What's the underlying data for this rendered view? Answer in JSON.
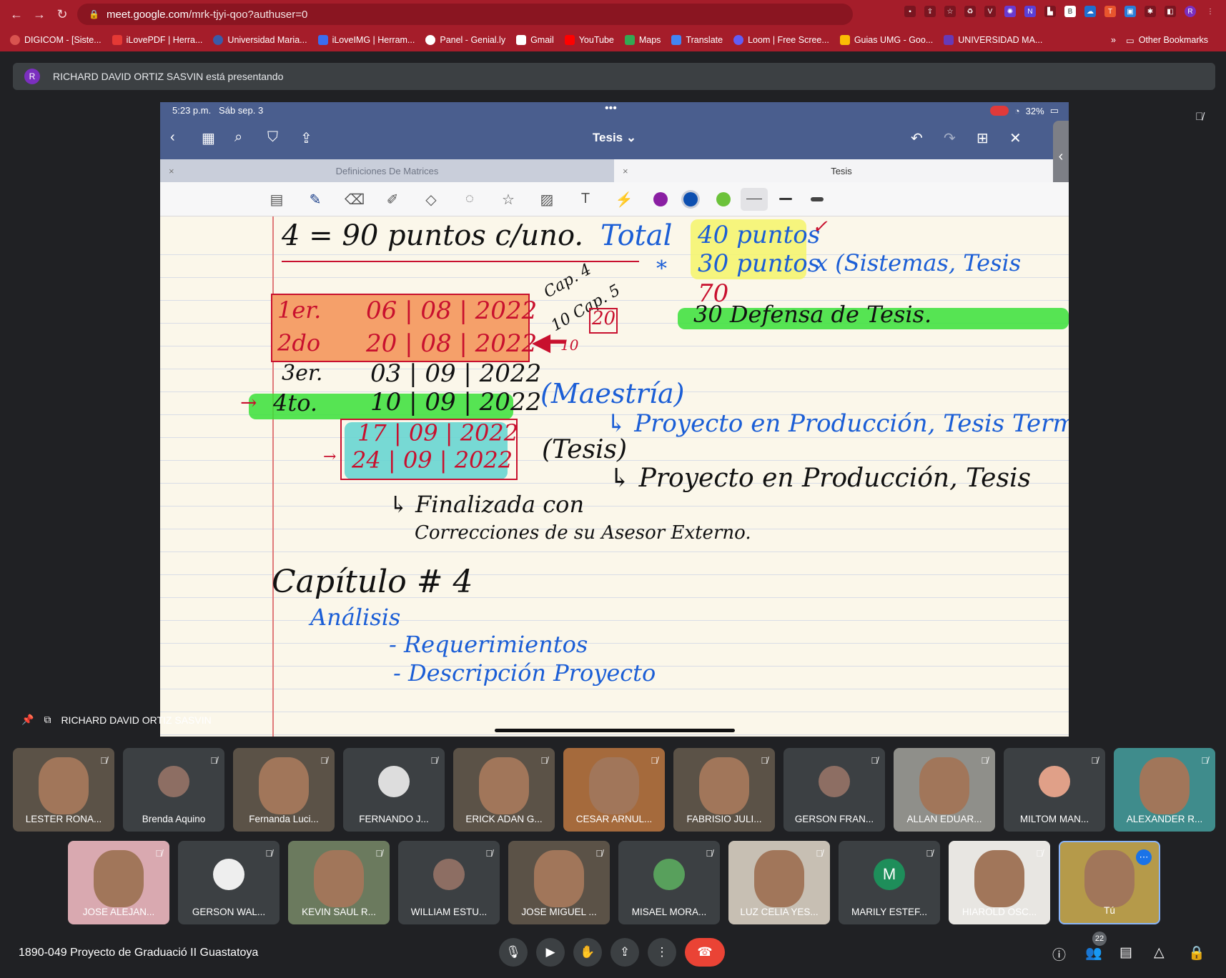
{
  "browser": {
    "url_host": "meet.google.com",
    "url_path": "/mrk-tjyi-qoo?authuser=0",
    "bookmarks": [
      "DIGICOM - [Siste...",
      "iLovePDF | Herra...",
      "Universidad Maria...",
      "iLoveIMG | Herram...",
      "Panel - Genial.ly",
      "Gmail",
      "YouTube",
      "Maps",
      "Translate",
      "Loom | Free Scree...",
      "Guias UMG - Goo...",
      "UNIVERSIDAD MA..."
    ],
    "more_bookmarks": "»",
    "other_bookmarks": "Other Bookmarks",
    "profile_initial": "R"
  },
  "presenter_bar": {
    "initial": "R",
    "text": "RICHARD DAVID ORTIZ SASVIN está presentando"
  },
  "ipad": {
    "time": "5:23 p.m.",
    "date": "Sáb sep. 3",
    "battery": "32%",
    "title": "Tesis ⌄",
    "tabs": [
      "Definiciones De Matrices",
      "Tesis"
    ]
  },
  "notes": {
    "line1": "4 = 90 puntos c/uno.",
    "total": "Total",
    "p40": "40 puntos",
    "p30": "30 puntos",
    "sistemas": "x (Sistemas, Tesis",
    "p70": "70",
    "p30b": "30 Defensa de Tesis.",
    "cap4": "Cap. 4",
    "cap5": "10 Cap. 5",
    "ten": "10",
    "ten2": "10",
    "twenty": "20",
    "d1_label": "1er.",
    "d1": "06 | 08 | 2022",
    "d2_label": "2do",
    "d2": "20 | 08 | 2022",
    "d3_label": "3er.",
    "d3": "03 | 09 | 2022",
    "d4_label": "4to.",
    "d4": "10 | 09 | 2022",
    "d5": "17 | 09 | 2022",
    "d6": "24 | 09 | 2022",
    "maestria": "(Maestría)",
    "maestria_sub": "↳ Proyecto en Producción, Tesis Term",
    "tesis": "(Tesis)",
    "tesis_sub": "↳ Proyecto en Producción, Tesis",
    "finalizada": "↳ Finalizada con",
    "correcciones": "Correcciones de su Asesor Externo.",
    "capitulo": "Capítulo # 4",
    "analisis": "Análisis",
    "req": "- Requerimientos",
    "desc": "- Descripción Proyecto"
  },
  "pinned_label": "RICHARD DAVID ORTIZ SASVIN",
  "participants_row1": [
    "LESTER RONA...",
    "Brenda Aquino",
    "Fernanda Luci...",
    "FERNANDO J...",
    "ERICK ADAN G...",
    "CESAR ARNUL...",
    "FABRISIO JULI...",
    "GERSON FRAN...",
    "ALLAN EDUAR...",
    "MILTOM MAN...",
    "ALEXANDER R..."
  ],
  "participants_row2": [
    "JOSE ALEJAN...",
    "GERSON WAL...",
    "KEVIN SAUL R...",
    "WILLIAM ESTU...",
    "JOSE MIGUEL ...",
    "MISAEL MORA...",
    "LUZ CELIA YES...",
    "MARILY ESTEF...",
    "HIAROLD OSC...",
    "Tú"
  ],
  "marily_initial": "M",
  "meeting": {
    "title": "1890-049 Proyecto de Graduació II Guastatoya",
    "participant_count": "22"
  },
  "colors": {
    "chrome_red": "#a51d2a",
    "meet_bg": "#202124",
    "hangup": "#ea4335",
    "ipad_header": "#4a5e8e"
  }
}
